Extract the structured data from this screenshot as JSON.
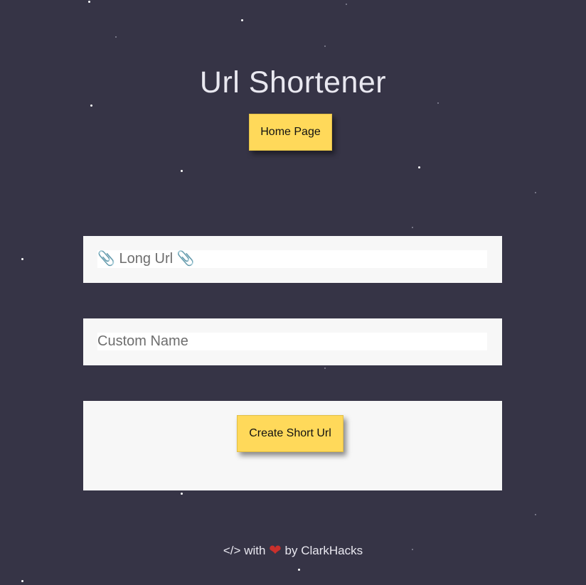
{
  "header": {
    "title": "Url Shortener",
    "home_button_label": "Home Page"
  },
  "form": {
    "long_url_placeholder": "📎 Long Url 📎",
    "custom_name_placeholder": "Custom Name",
    "create_button_label": "Create Short Url"
  },
  "footer": {
    "code_symbol": "</>",
    "with_text": "with",
    "heart_icon": "heart-icon",
    "by_text": "by ClarkHacks"
  },
  "colors": {
    "background": "#363446",
    "accent_button": "#ffd95a",
    "panel": "#f7f7f7",
    "heart": "#c9302c"
  }
}
